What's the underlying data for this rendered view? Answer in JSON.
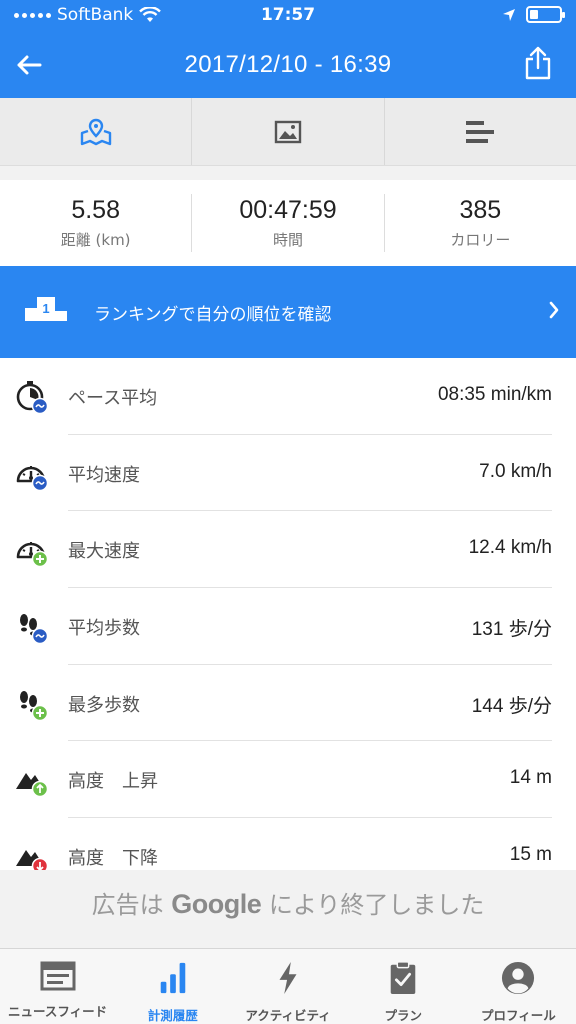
{
  "status": {
    "carrier": "SoftBank",
    "time": "17:57"
  },
  "nav": {
    "title": "2017/12/10 - 16:39"
  },
  "tabs": [
    {
      "icon": "map-icon",
      "active": true
    },
    {
      "icon": "image-icon",
      "active": false
    },
    {
      "icon": "bar-list-icon",
      "active": false
    }
  ],
  "summary": [
    {
      "value": "5.58",
      "label": "距離 (km)"
    },
    {
      "value": "00:47:59",
      "label": "時間"
    },
    {
      "value": "385",
      "label": "カロリー"
    }
  ],
  "ranking": {
    "label": "ランキングで自分の順位を確認",
    "badge": "1"
  },
  "metrics": [
    {
      "label": "ペース平均",
      "value": "08:35 min/km",
      "icon": "stopwatch-average-icon"
    },
    {
      "label": "平均速度",
      "value": "7.0 km/h",
      "icon": "speedometer-average-icon"
    },
    {
      "label": "最大速度",
      "value": "12.4 km/h",
      "icon": "speedometer-max-icon"
    },
    {
      "label": "平均歩数",
      "value": "131 歩/分",
      "icon": "footsteps-average-icon"
    },
    {
      "label": "最多歩数",
      "value": "144 歩/分",
      "icon": "footsteps-max-icon"
    },
    {
      "label": "高度　上昇",
      "value": "14 m",
      "icon": "mountain-up-icon"
    },
    {
      "label": "高度　下降",
      "value": "15 m",
      "icon": "mountain-down-icon"
    }
  ],
  "ad": {
    "prefix": "広告は",
    "brand": "Google",
    "suffix": "により終了しました"
  },
  "tabbar": [
    {
      "label": "ニュースフィード",
      "icon": "newsfeed-icon",
      "active": false
    },
    {
      "label": "計測履歴",
      "icon": "history-chart-icon",
      "active": true
    },
    {
      "label": "アクティビティ",
      "icon": "lightning-icon",
      "active": false
    },
    {
      "label": "プラン",
      "icon": "clipboard-icon",
      "active": false
    },
    {
      "label": "プロフィール",
      "icon": "profile-icon",
      "active": false
    }
  ],
  "colors": {
    "primary": "#2a86f1",
    "badge_blue": "#2a5cc4",
    "badge_green": "#6cc04a",
    "badge_red": "#e0323c"
  }
}
